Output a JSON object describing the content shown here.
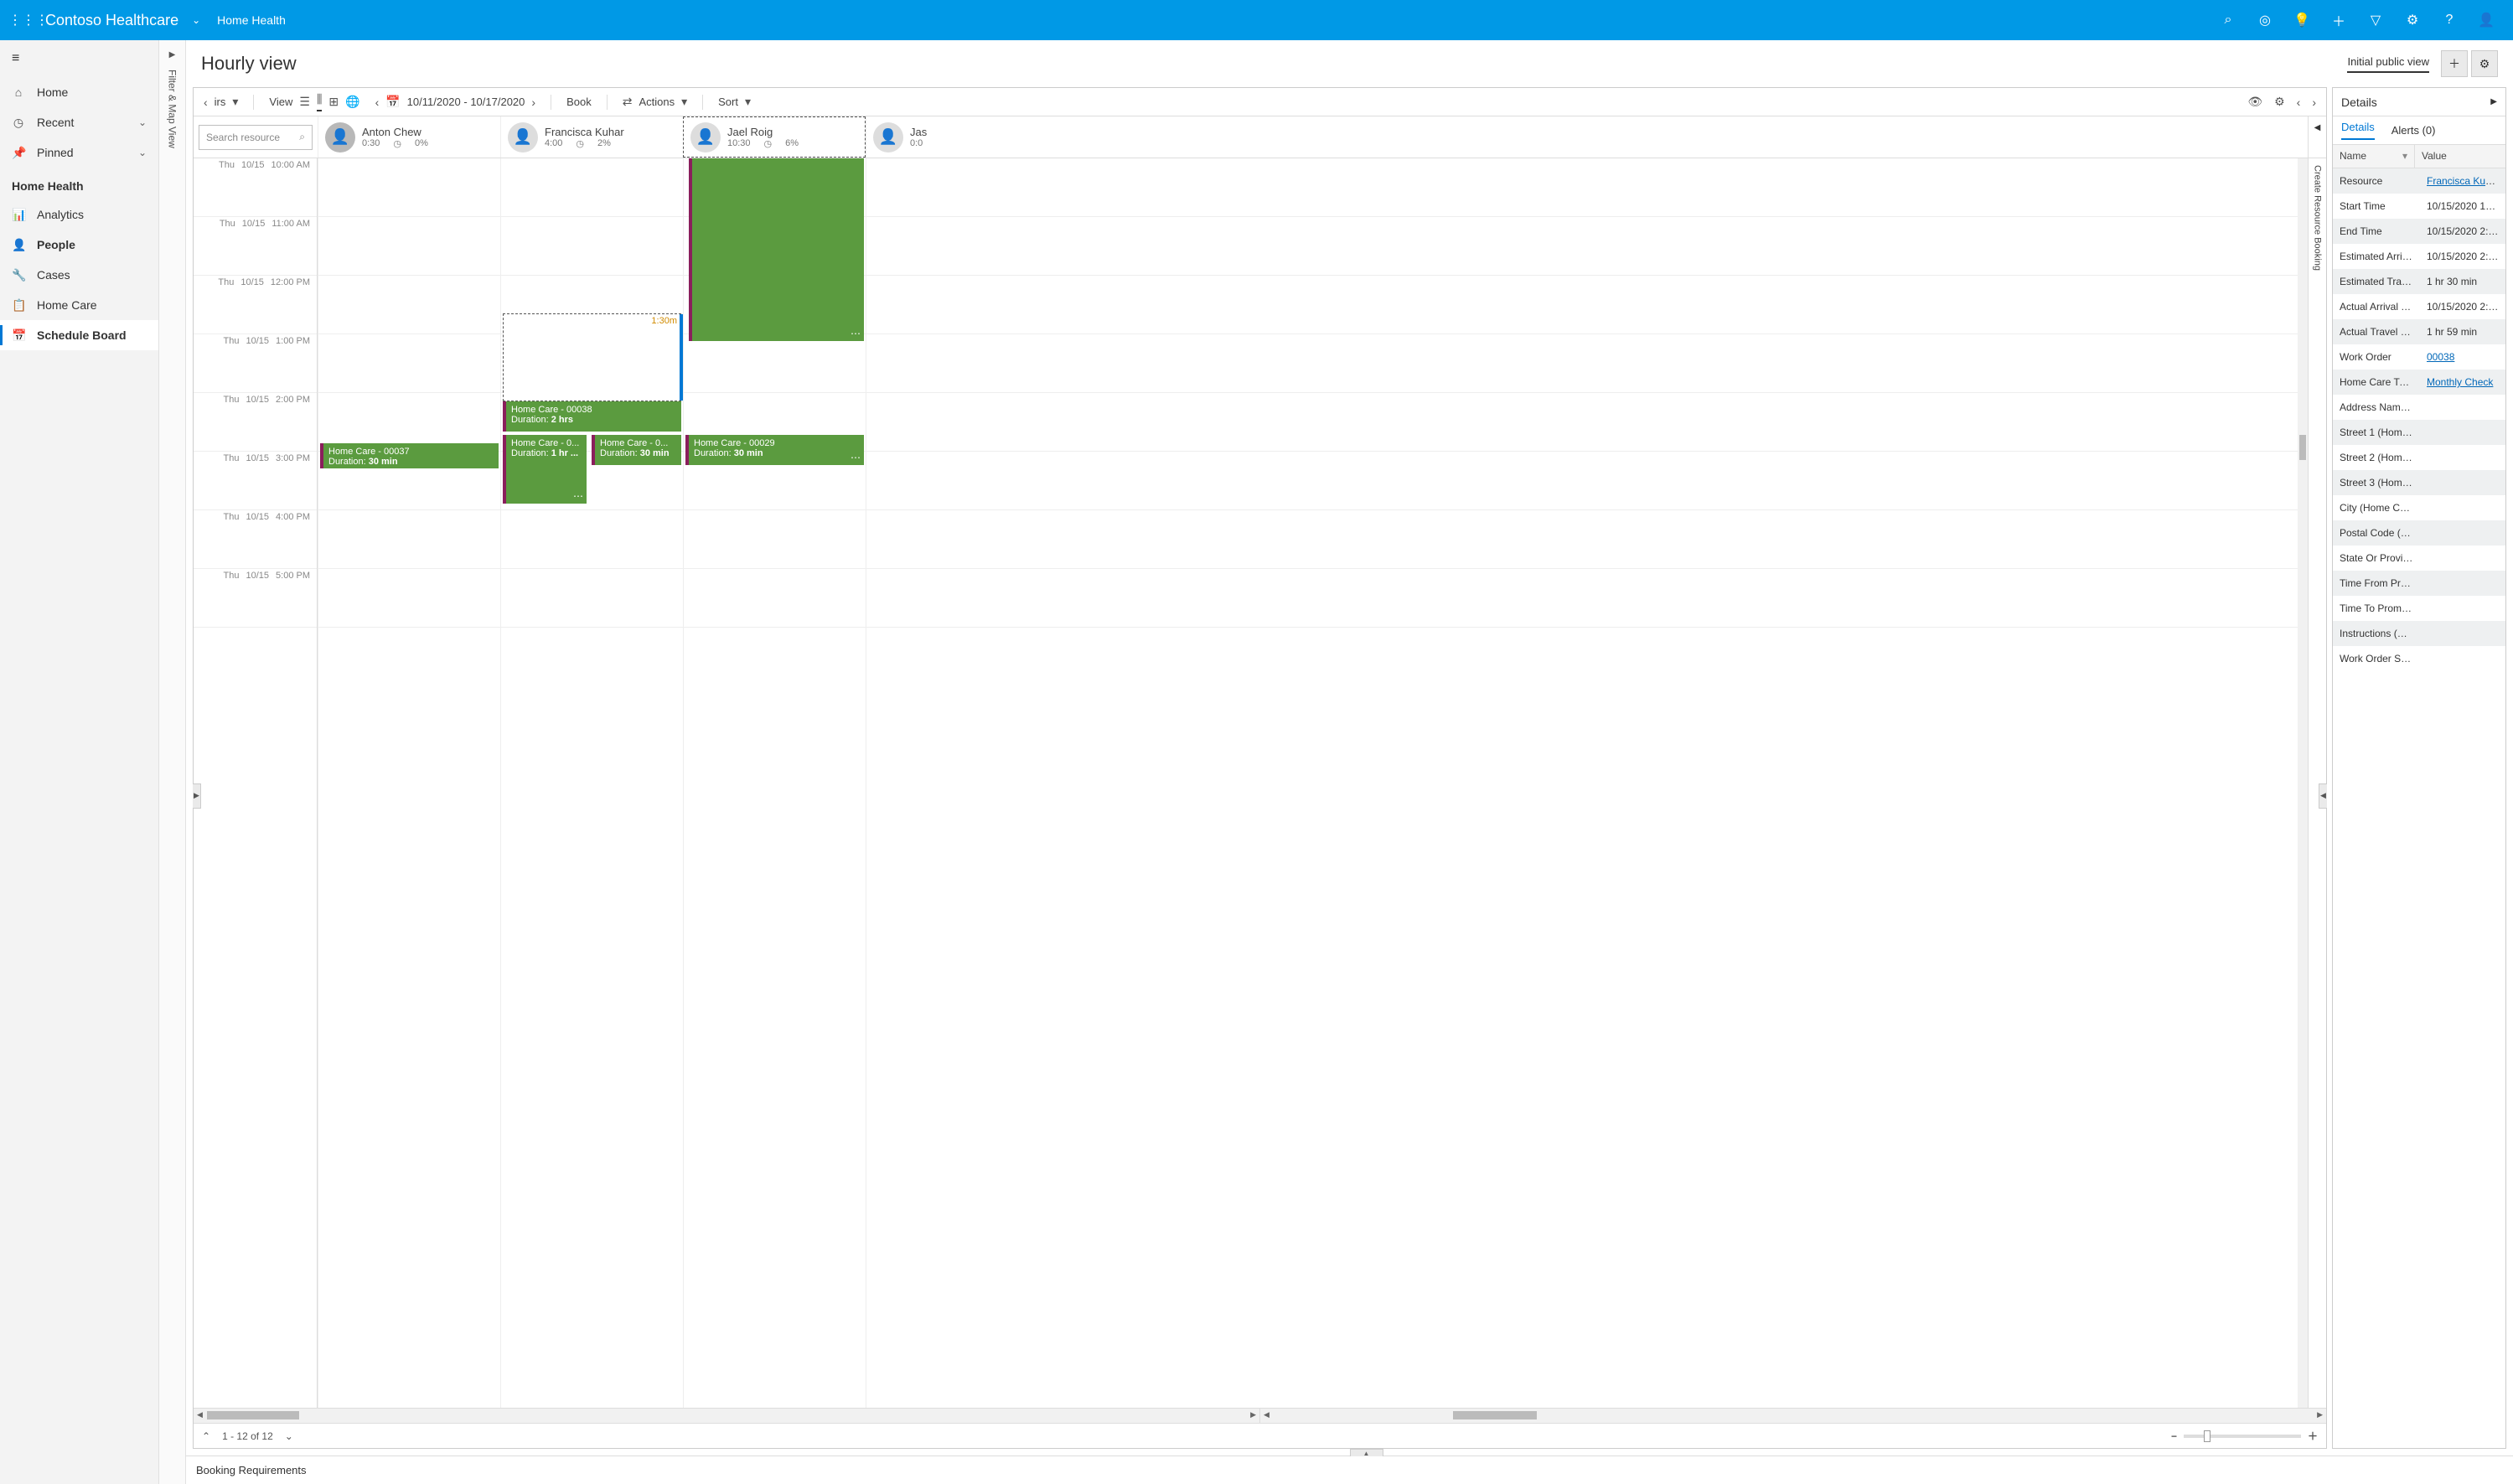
{
  "topbar": {
    "brand": "Contoso Healthcare",
    "area": "Home Health"
  },
  "nav": {
    "home": "Home",
    "recent": "Recent",
    "pinned": "Pinned",
    "section": "Home Health",
    "items": {
      "analytics": "Analytics",
      "people": "People",
      "cases": "Cases",
      "homecare": "Home Care",
      "schedule": "Schedule Board"
    }
  },
  "rail": {
    "label": "Filter & Map View"
  },
  "page": {
    "title": "Hourly view",
    "viewname": "Initial public view"
  },
  "toolbar": {
    "irs": "irs",
    "view": "View",
    "daterange": "10/11/2020 - 10/17/2020",
    "book": "Book",
    "actions": "Actions",
    "sort": "Sort"
  },
  "search": {
    "placeholder": "Search resource"
  },
  "resources": [
    {
      "name": "Anton Chew",
      "time": "0:30",
      "pct": "0%"
    },
    {
      "name": "Francisca Kuhar",
      "time": "4:00",
      "pct": "2%"
    },
    {
      "name": "Jael Roig",
      "time": "10:30",
      "pct": "6%"
    },
    {
      "name": "Jas",
      "time": "0:0",
      "pct": ""
    }
  ],
  "timeslots": [
    {
      "day": "Thu",
      "date": "10/15",
      "time": "10:00 AM"
    },
    {
      "day": "Thu",
      "date": "10/15",
      "time": "11:00 AM"
    },
    {
      "day": "Thu",
      "date": "10/15",
      "time": "12:00 PM"
    },
    {
      "day": "Thu",
      "date": "10/15",
      "time": "1:00 PM"
    },
    {
      "day": "Thu",
      "date": "10/15",
      "time": "2:00 PM"
    },
    {
      "day": "Thu",
      "date": "10/15",
      "time": "3:00 PM"
    },
    {
      "day": "Thu",
      "date": "10/15",
      "time": "4:00 PM"
    },
    {
      "day": "Thu",
      "date": "10/15",
      "time": "5:00 PM"
    }
  ],
  "drag": {
    "label": "1:30m"
  },
  "bookings": {
    "b1": {
      "title": "Home Care - 00038",
      "dur": "2 hrs"
    },
    "b2": {
      "title": "Home Care - 00037",
      "dur": "30 min"
    },
    "b3": {
      "title": "Home Care - 0...",
      "dur": "1 hr ..."
    },
    "b4": {
      "title": "Home Care - 0...",
      "dur": "30 min"
    },
    "b5": {
      "title": "Home Care - 00029",
      "dur": "30 min"
    }
  },
  "rightedge": {
    "label": "Create Resource Booking"
  },
  "footer": {
    "range": "1 - 12 of 12"
  },
  "details": {
    "header": "Details",
    "tab_details": "Details",
    "tab_alerts": "Alerts (0)",
    "col_name": "Name",
    "col_value": "Value",
    "rows": [
      {
        "n": "Resource",
        "v": "Francisca Kuhar",
        "link": true
      },
      {
        "n": "Start Time",
        "v": "10/15/2020 12:33 ..."
      },
      {
        "n": "End Time",
        "v": "10/15/2020 2:33 P..."
      },
      {
        "n": "Estimated Arrival ...",
        "v": "10/15/2020 2:03 P..."
      },
      {
        "n": "Estimated Travel ...",
        "v": "1 hr 30 min"
      },
      {
        "n": "Actual Arrival Time",
        "v": "10/15/2020 2:32 P..."
      },
      {
        "n": "Actual Travel Dur...",
        "v": "1 hr 59 min"
      },
      {
        "n": "Work Order",
        "v": "00038",
        "link": true
      },
      {
        "n": "Home Care Type ...",
        "v": "Monthly Check",
        "link": true
      },
      {
        "n": "Address Name (H...",
        "v": ""
      },
      {
        "n": "Street 1 (Home C...",
        "v": ""
      },
      {
        "n": "Street 2 (Home C...",
        "v": ""
      },
      {
        "n": "Street 3 (Home C...",
        "v": ""
      },
      {
        "n": "City (Home Care)",
        "v": ""
      },
      {
        "n": "Postal Code (Ho...",
        "v": ""
      },
      {
        "n": "State Or Province...",
        "v": ""
      },
      {
        "n": "Time From Promi...",
        "v": ""
      },
      {
        "n": "Time To Promised...",
        "v": ""
      },
      {
        "n": "Instructions (Hom...",
        "v": ""
      },
      {
        "n": "Work Order Sum...",
        "v": ""
      }
    ]
  },
  "bottom": {
    "label": "Booking Requirements"
  }
}
